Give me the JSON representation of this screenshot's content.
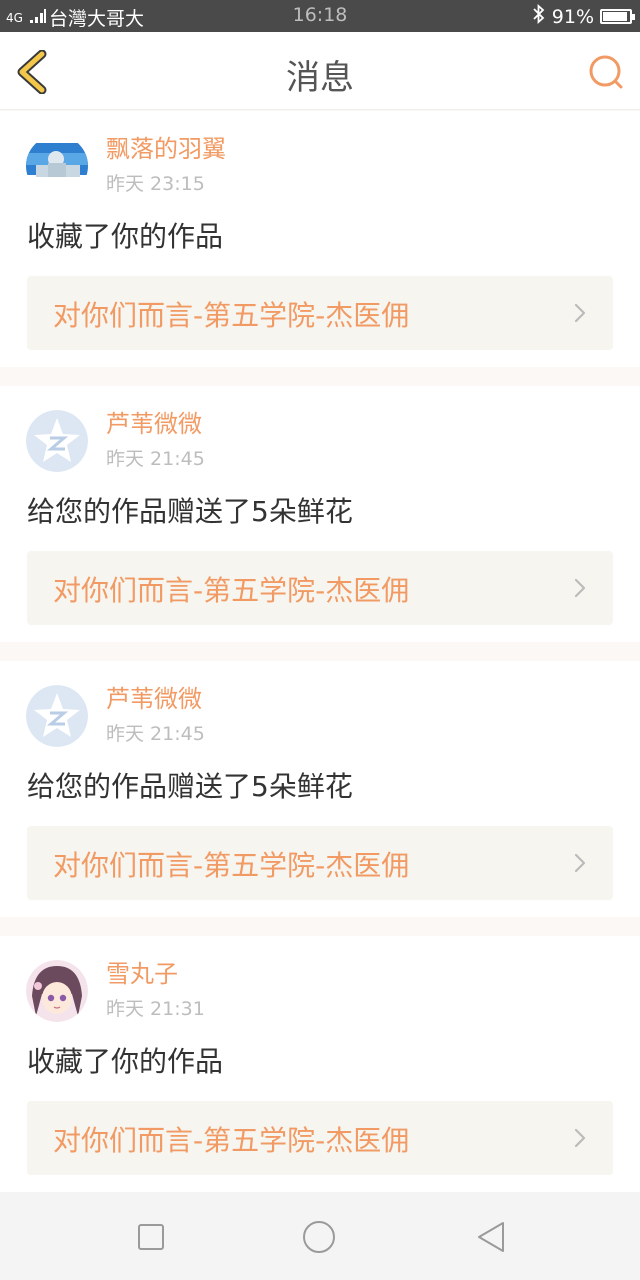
{
  "status_bar": {
    "network": "4G",
    "carrier": "台灣大哥大",
    "time": "16:18",
    "battery": "91%",
    "battery_level": 0.91
  },
  "nav": {
    "title": "消息",
    "icons": {
      "back": "chevron-left-icon",
      "search": "search-icon"
    }
  },
  "colors": {
    "accent": "#f29a63",
    "back_icon": "#f3c84a",
    "link_bg": "#f6f5f0"
  },
  "messages": [
    {
      "username": "飘落的羽翼",
      "time": "昨天 23:15",
      "action": "收藏了你的作品",
      "work_title": "对你们而言-第五学院-杰医佣",
      "avatar": "photo-avatar"
    },
    {
      "username": "芦苇微微",
      "time": "昨天 21:45",
      "action": "给您的作品赠送了5朵鲜花",
      "work_title": "对你们而言-第五学院-杰医佣",
      "avatar": "qzone-default-avatar"
    },
    {
      "username": "芦苇微微",
      "time": "昨天 21:45",
      "action": "给您的作品赠送了5朵鲜花",
      "work_title": "对你们而言-第五学院-杰医佣",
      "avatar": "qzone-default-avatar"
    },
    {
      "username": "雪丸子",
      "time": "昨天 21:31",
      "action": "收藏了你的作品",
      "work_title": "对你们而言-第五学院-杰医佣",
      "avatar": "anime-girl-avatar"
    }
  ],
  "system_nav": {
    "icons": [
      "recent-apps-icon",
      "home-icon",
      "back-triangle-icon"
    ]
  }
}
